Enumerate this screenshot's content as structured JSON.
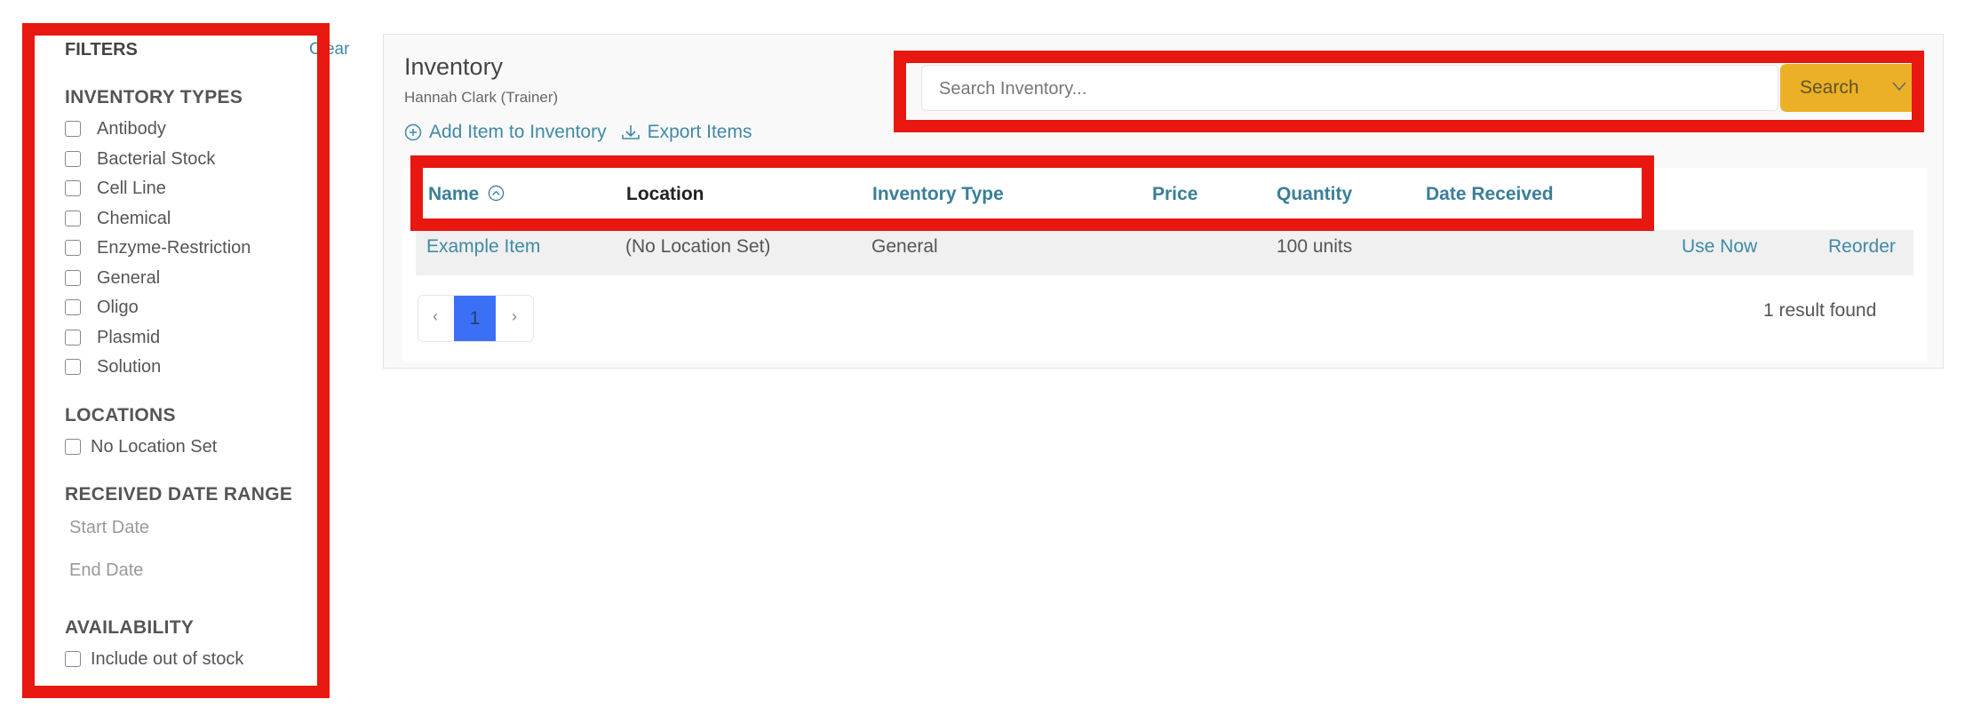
{
  "filters": {
    "title": "FILTERS",
    "clear_label": "Clear",
    "inventory_types": {
      "heading": "INVENTORY TYPES",
      "items": [
        "Antibody",
        "Bacterial Stock",
        "Cell Line",
        "Chemical",
        "Enzyme-Restriction",
        "General",
        "Oligo",
        "Plasmid",
        "Solution"
      ]
    },
    "locations": {
      "heading": "LOCATIONS",
      "items": [
        "No Location Set"
      ]
    },
    "date_range": {
      "heading": "RECEIVED DATE RANGE",
      "start_placeholder": "Start Date",
      "end_placeholder": "End Date"
    },
    "availability": {
      "heading": "AVAILABILITY",
      "items": [
        "Include out of stock"
      ]
    }
  },
  "header": {
    "title": "Inventory",
    "subtitle": "Hannah Clark (Trainer)",
    "add_item_label": "Add Item to Inventory",
    "export_label": "Export Items"
  },
  "search": {
    "placeholder": "Search Inventory...",
    "button_label": "Search",
    "button_color": "#ebb025"
  },
  "table": {
    "columns": [
      "Name",
      "Location",
      "Inventory Type",
      "Price",
      "Quantity",
      "Date Received"
    ],
    "sort_column": "Name",
    "rows": [
      {
        "name": "Example Item",
        "location": "(No Location Set)",
        "inventory_type": "General",
        "price": "",
        "quantity": "100 units",
        "date_received": "",
        "use_now_label": "Use Now",
        "reorder_label": "Reorder"
      }
    ]
  },
  "pagination": {
    "prev": "‹",
    "current_page": "1",
    "next": "›",
    "active_color": "#3b6ff6"
  },
  "result_count": "1 result found",
  "accent_color": "#3f8aa6",
  "highlight_color": "#e8170f"
}
